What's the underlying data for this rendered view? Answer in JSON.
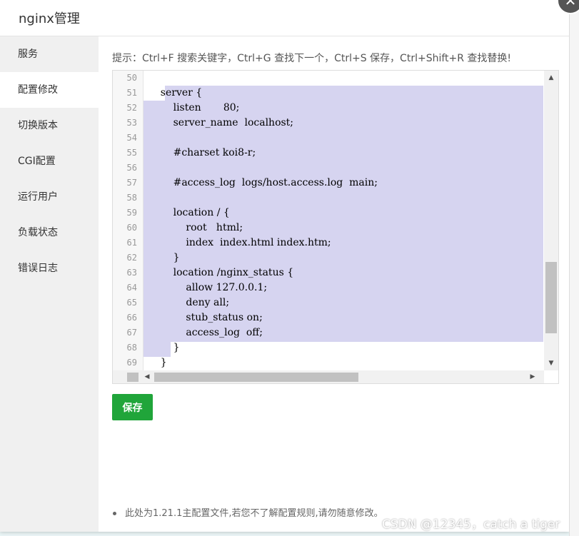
{
  "dialog": {
    "title": "nginx管理",
    "close_label": "✕"
  },
  "sidebar": {
    "items": [
      {
        "label": "服务"
      },
      {
        "label": "配置修改"
      },
      {
        "label": "切换版本"
      },
      {
        "label": "CGI配置"
      },
      {
        "label": "运行用户"
      },
      {
        "label": "负载状态"
      },
      {
        "label": "错误日志"
      }
    ]
  },
  "main": {
    "tip": "提示：Ctrl+F 搜索关键字，Ctrl+G 查找下一个，Ctrl+S 保存，Ctrl+Shift+R 查找替换!",
    "editor": {
      "line_numbers": [
        "50",
        "51",
        "52",
        "53",
        "54",
        "55",
        "56",
        "57",
        "58",
        "59",
        "60",
        "61",
        "62",
        "63",
        "64",
        "65",
        "66",
        "67",
        "68",
        "69"
      ],
      "lines": [
        "",
        "    server {",
        "        listen       80;",
        "        server_name  localhost;",
        "",
        "        #charset koi8-r;",
        "",
        "        #access_log  logs/host.access.log  main;",
        "",
        "        location / {",
        "            root   html;",
        "            index  index.html index.htm;",
        "        }",
        "        location /nginx_status {",
        "            allow 127.0.0.1;",
        "            deny all;",
        "            stub_status on;",
        "            access_log  off;",
        "        }",
        "    }"
      ]
    },
    "save_label": "保存",
    "note": "此处为1.21.1主配置文件,若您不了解配置规则,请勿随意修改。"
  },
  "watermark": "CSDN @12345，catch a tiger",
  "colors": {
    "accent": "#20a53a",
    "selection": "#d6d4f0"
  }
}
